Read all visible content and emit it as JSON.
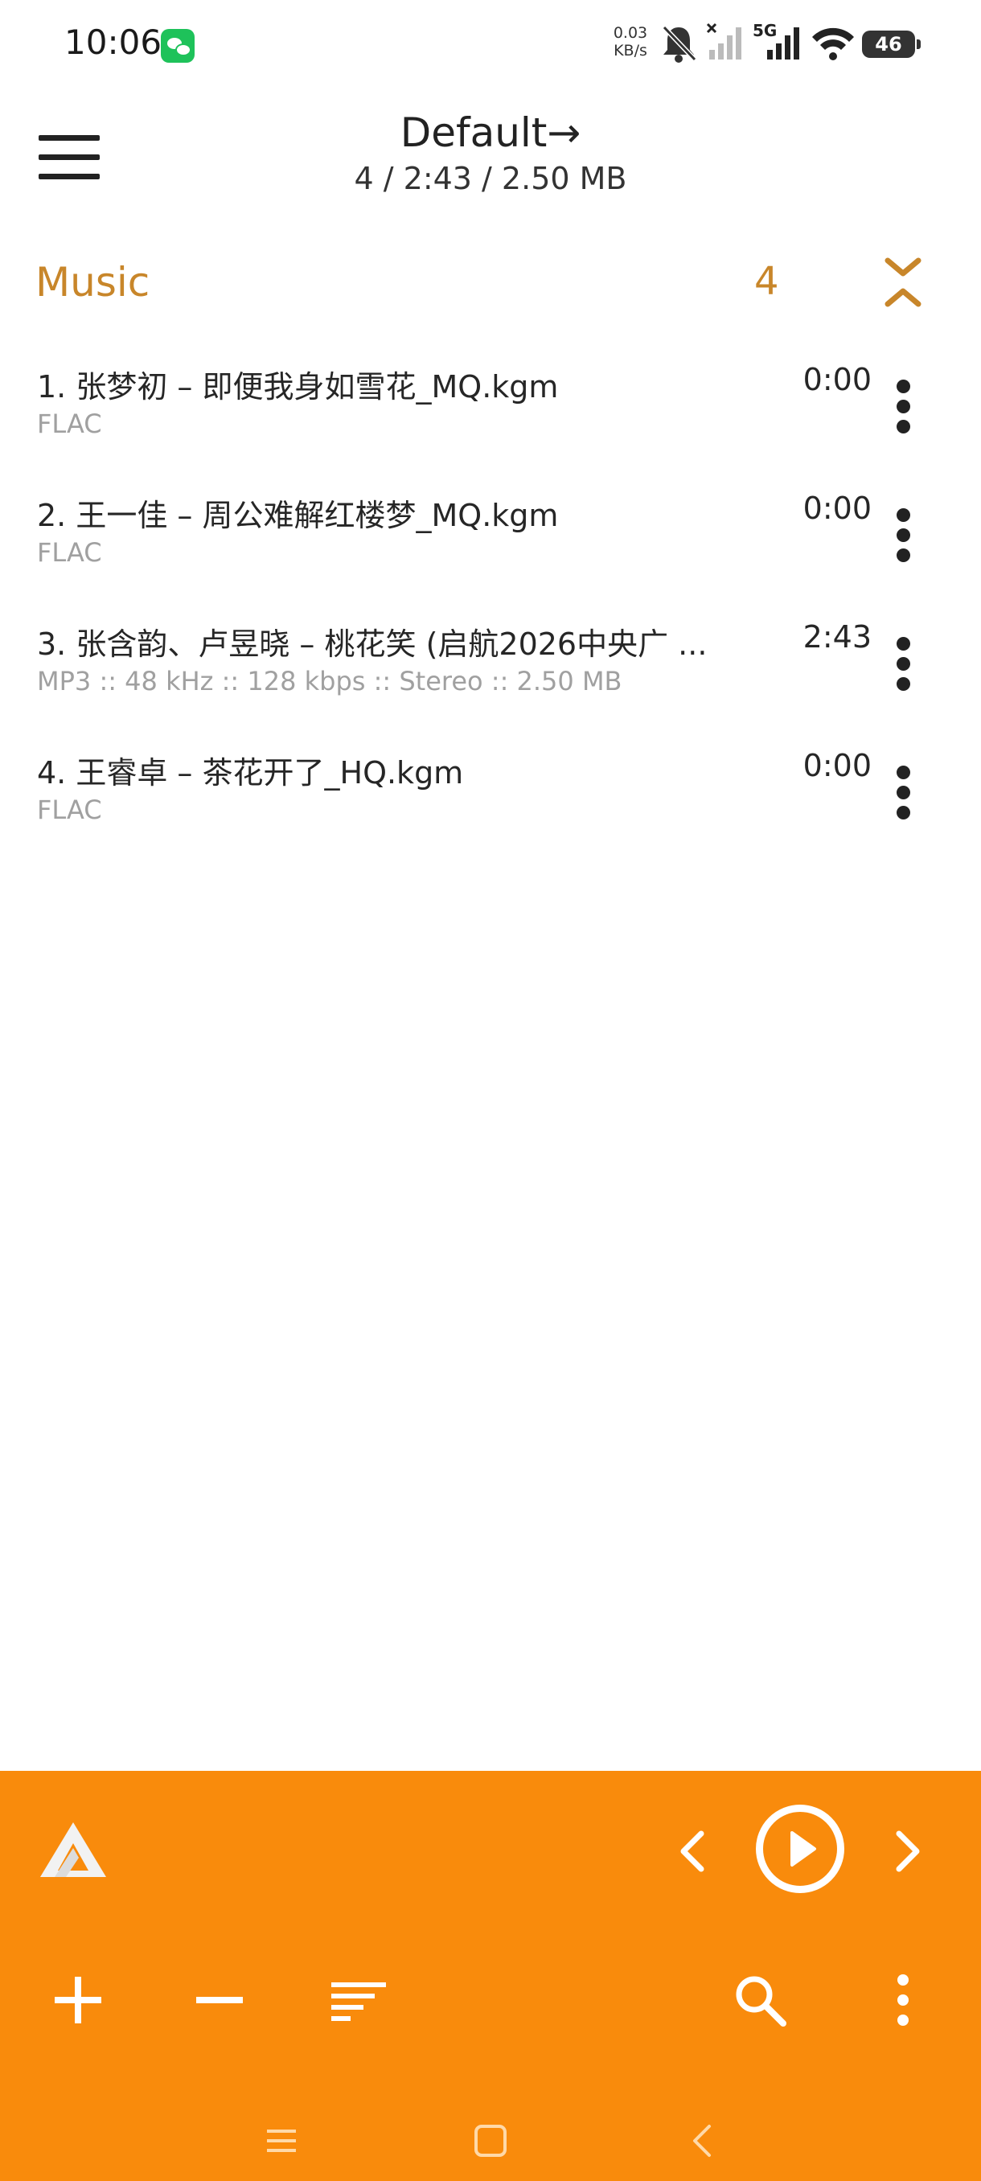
{
  "status_bar": {
    "time": "10:06",
    "net_speed_value": "0.03",
    "net_speed_unit": "KB/s",
    "network_type": "5G",
    "battery": "46",
    "icons": [
      "wechat-icon",
      "bell-muted-icon",
      "signal-off-icon",
      "signal-5g-icon",
      "wifi-icon",
      "battery-icon"
    ]
  },
  "header": {
    "title": "Default→",
    "subtitle": "4 / 2:43 / 2.50 MB"
  },
  "playlist": {
    "name": "Music",
    "count": "4"
  },
  "tracks": [
    {
      "title": "1. 张梦初 – 即便我身如雪花_MQ.kgm",
      "info": "FLAC",
      "duration": "0:00"
    },
    {
      "title": "2. 王一佳 – 周公难解红楼梦_MQ.kgm",
      "info": "FLAC",
      "duration": "0:00"
    },
    {
      "title": "3. 张含韵、卢昱晓 – 桃花笑 (启航2026中央广 ...",
      "info": "MP3 :: 48 kHz :: 128 kbps :: Stereo :: 2.50 MB",
      "duration": "2:43"
    },
    {
      "title": "4. 王睿卓 – 茶花开了_HQ.kgm",
      "info": "FLAC",
      "duration": "0:00"
    }
  ],
  "colors": {
    "accent": "#c8862a",
    "player_bg": "#f98b0c",
    "text": "#262626",
    "secondary_text": "#a0a0a0"
  }
}
